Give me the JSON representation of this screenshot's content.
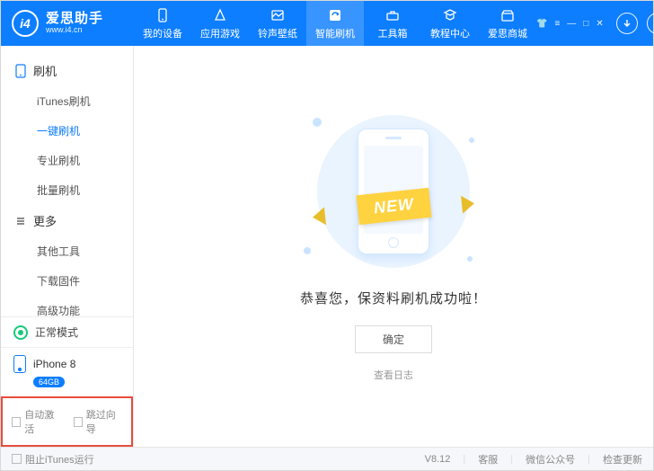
{
  "header": {
    "logo_text": "爱思助手",
    "logo_url": "www.i4.cn",
    "tabs": [
      {
        "label": "我的设备"
      },
      {
        "label": "应用游戏"
      },
      {
        "label": "铃声壁纸"
      },
      {
        "label": "智能刷机"
      },
      {
        "label": "工具箱"
      },
      {
        "label": "教程中心"
      },
      {
        "label": "爱思商城"
      }
    ]
  },
  "sidebar": {
    "section1_title": "刷机",
    "section2_title": "更多",
    "flash_items": [
      {
        "label": "iTunes刷机"
      },
      {
        "label": "一键刷机"
      },
      {
        "label": "专业刷机"
      },
      {
        "label": "批量刷机"
      }
    ],
    "more_items": [
      {
        "label": "其他工具"
      },
      {
        "label": "下载固件"
      },
      {
        "label": "高级功能"
      }
    ],
    "status_text": "正常模式",
    "device_name": "iPhone 8",
    "device_storage": "64GB",
    "opt_auto_activate": "自动激活",
    "opt_skip_guide": "跳过向导"
  },
  "main": {
    "ribbon_text": "NEW",
    "success_message": "恭喜您，保资料刷机成功啦！",
    "ok_button": "确定",
    "view_log": "查看日志"
  },
  "footer": {
    "block_itunes": "阻止iTunes运行",
    "version": "V8.12",
    "support": "客服",
    "wechat": "微信公众号",
    "update": "检查更新"
  }
}
